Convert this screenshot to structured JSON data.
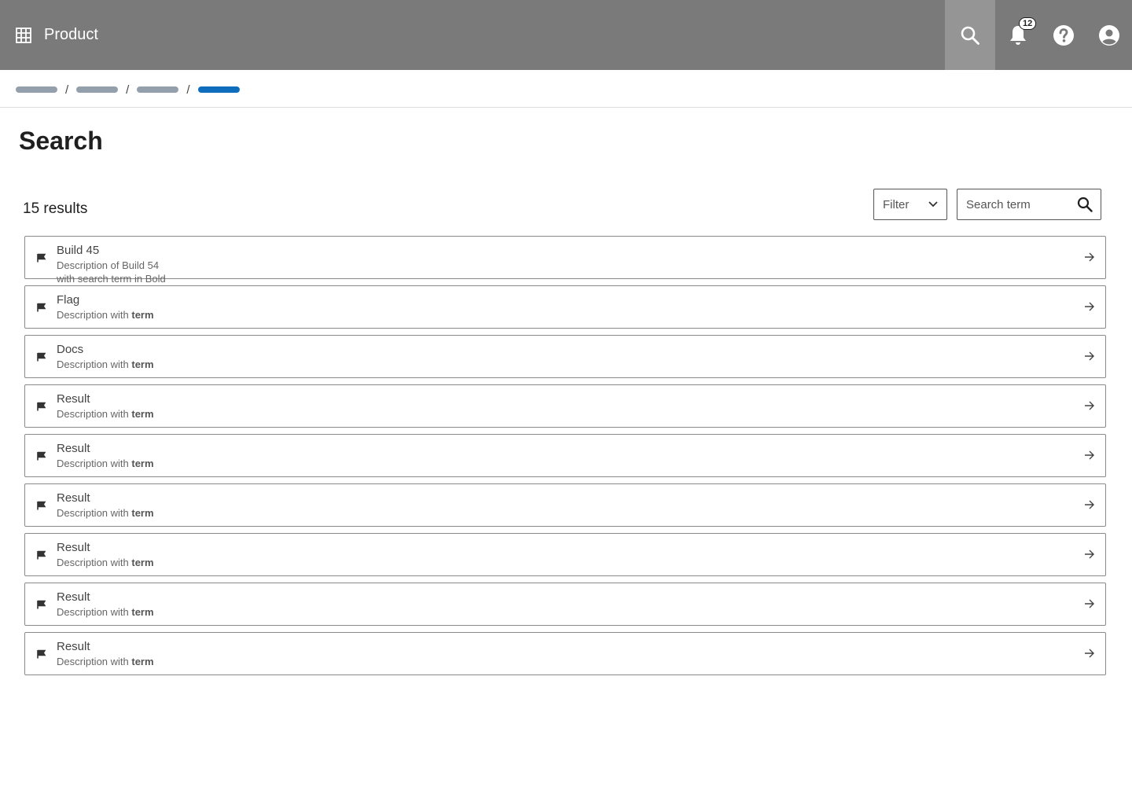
{
  "header": {
    "product_name": "Product",
    "notifications_count": "12",
    "bg_color": "#7a7a7a",
    "active_color": "#959595"
  },
  "breadcrumb": {
    "items": [
      "",
      "",
      "",
      ""
    ],
    "current_color": "#0f6dbd",
    "inactive_color": "#93a0ab"
  },
  "page": {
    "title": "Search",
    "results_count": "15 results"
  },
  "filter": {
    "label": "Filter",
    "search_placeholder": "Search term"
  },
  "results": [
    {
      "title": "Build 45",
      "description": "Description of Build 54 with search term in Bold",
      "term": ""
    },
    {
      "title": "Flag",
      "description": "Description with ",
      "term": "term"
    },
    {
      "title": "Docs",
      "description": "Description with ",
      "term": "term"
    },
    {
      "title": "Result",
      "description": "Description with ",
      "term": "term"
    },
    {
      "title": "Result",
      "description": "Description with ",
      "term": "term"
    },
    {
      "title": "Result",
      "description": "Description with ",
      "term": "term"
    },
    {
      "title": "Result",
      "description": "Description with ",
      "term": "term"
    },
    {
      "title": "Result",
      "description": "Description with ",
      "term": "term"
    },
    {
      "title": "Result",
      "description": "Description with ",
      "term": "term"
    }
  ]
}
